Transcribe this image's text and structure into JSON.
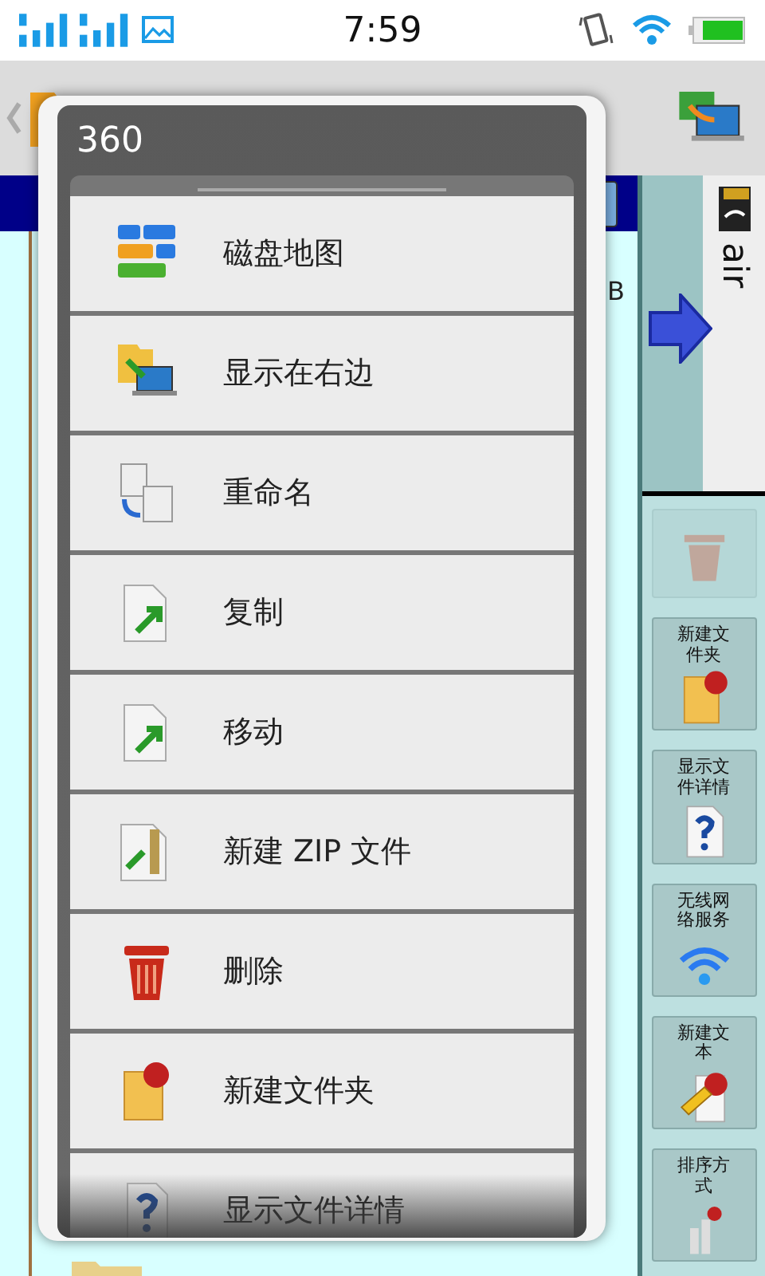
{
  "status_bar": {
    "time": "7:59"
  },
  "file_list": {
    "size_fragment": "B"
  },
  "storage_panel": {
    "label": "air"
  },
  "trash_button": {
    "disabled": true
  },
  "side_buttons": [
    {
      "label": "新建文件夹"
    },
    {
      "label": "显示文件详情"
    },
    {
      "label": "无线网络服务"
    },
    {
      "label": "新建文本"
    },
    {
      "label": "排序方式"
    }
  ],
  "dialog": {
    "title": "360",
    "items": [
      {
        "label": "磁盘地图"
      },
      {
        "label": "显示在右边"
      },
      {
        "label": "重命名"
      },
      {
        "label": "复制"
      },
      {
        "label": "移动"
      },
      {
        "label": "新建 ZIP 文件"
      },
      {
        "label": "删除"
      },
      {
        "label": "新建文件夹"
      },
      {
        "label": "显示文件详情"
      }
    ]
  }
}
